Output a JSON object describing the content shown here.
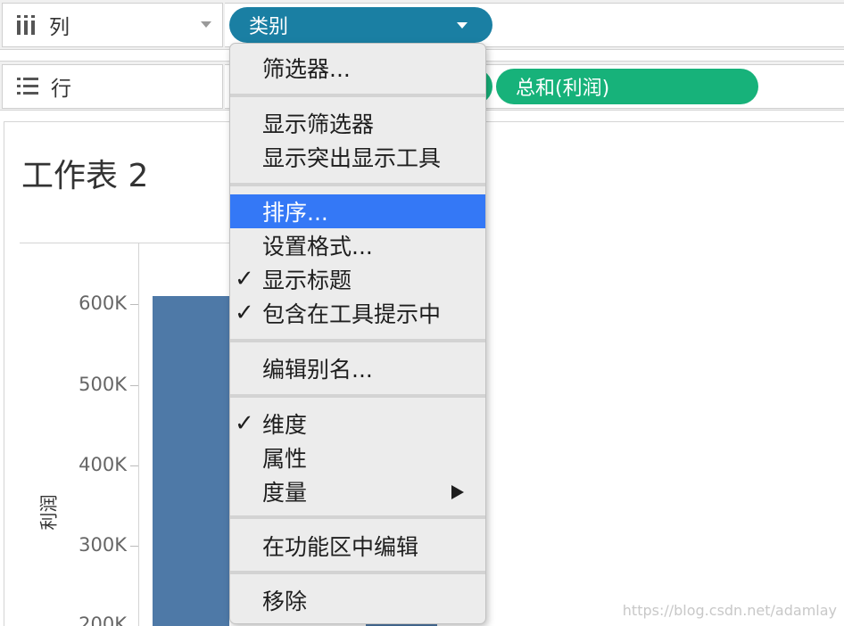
{
  "shelves": {
    "columns_label": "列",
    "rows_label": "行",
    "columns_pill": "类别",
    "rows_pill": "总和(利润)"
  },
  "sheet": {
    "title": "工作表 2",
    "axis_title": "利润",
    "ticks": [
      "600K",
      "500K",
      "400K",
      "300K",
      "200K"
    ]
  },
  "menu": {
    "items": [
      {
        "label": "筛选器...",
        "checked": false
      },
      {
        "label": "显示筛选器",
        "checked": false
      },
      {
        "label": "显示突出显示工具",
        "checked": false
      },
      {
        "label": "排序...",
        "checked": false,
        "highlighted": true
      },
      {
        "label": "设置格式...",
        "checked": false
      },
      {
        "label": "显示标题",
        "checked": true
      },
      {
        "label": "包含在工具提示中",
        "checked": true
      },
      {
        "label": "编辑别名...",
        "checked": false
      },
      {
        "label": "维度",
        "checked": true
      },
      {
        "label": "属性",
        "checked": false
      },
      {
        "label": "度量",
        "checked": false,
        "submenu": true
      },
      {
        "label": "在功能区中编辑",
        "checked": false
      },
      {
        "label": "移除",
        "checked": false
      }
    ],
    "check_glyph": "✓"
  },
  "chart_data": {
    "type": "bar",
    "ylabel": "利润",
    "ylim": [
      200000,
      650000
    ],
    "ticks": [
      600000,
      500000,
      400000,
      300000,
      200000
    ],
    "values": [
      610000
    ]
  },
  "colors": {
    "dimension_pill": "#1a7fa3",
    "measure_pill": "#17b27a",
    "bar": "#4e79a7",
    "menu_highlight": "#3478f6"
  },
  "watermark": "https://blog.csdn.net/adamlay"
}
